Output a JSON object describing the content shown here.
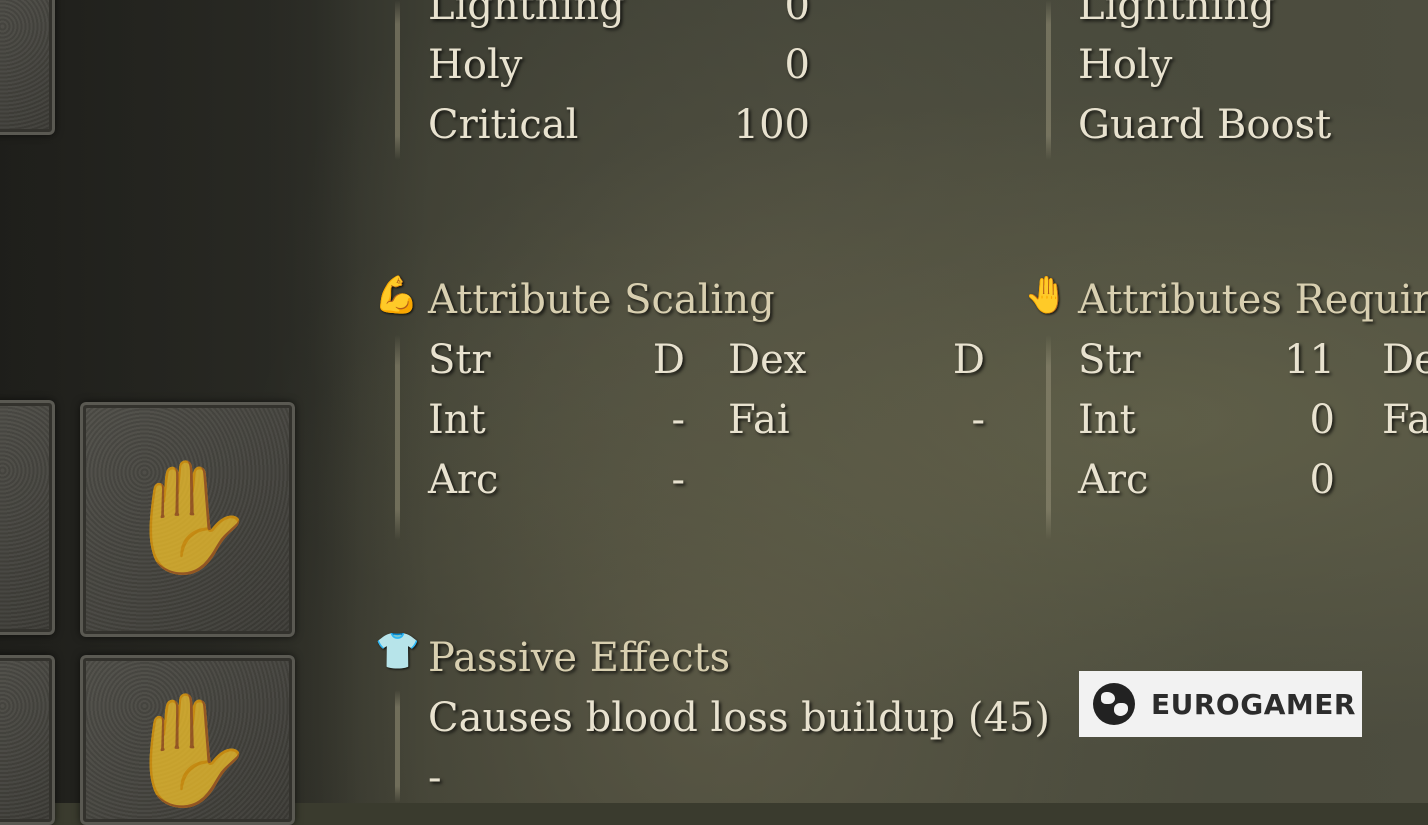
{
  "defense_left": {
    "rows": [
      {
        "label": "Lightning",
        "value": "0"
      },
      {
        "label": "Holy",
        "value": "0"
      },
      {
        "label": "Critical",
        "value": "100"
      }
    ]
  },
  "defense_right": {
    "rows": [
      {
        "label": "Lightning"
      },
      {
        "label": "Holy"
      },
      {
        "label": "Guard Boost"
      }
    ]
  },
  "attribute_scaling": {
    "title": "Attribute Scaling",
    "icon": "flexed-arm-icon",
    "rows": [
      {
        "label": "Str",
        "value": "D",
        "label2": "Dex",
        "value2": "D"
      },
      {
        "label": "Int",
        "value": "-",
        "label2": "Fai",
        "value2": "-"
      },
      {
        "label": "Arc",
        "value": "-"
      }
    ]
  },
  "attributes_required": {
    "title": "Attributes Required",
    "icon": "open-hand-icon",
    "rows": [
      {
        "label": "Str",
        "value": "11",
        "label2": "De"
      },
      {
        "label": "Int",
        "value": "0",
        "label2": "Fa"
      },
      {
        "label": "Arc",
        "value": "0"
      }
    ]
  },
  "passive_effects": {
    "title": "Passive Effects",
    "icon": "torso-icon",
    "effects": [
      "Causes blood loss buildup (45)",
      "-"
    ]
  },
  "watermark": {
    "text": "EUROGAMER",
    "icon": "globe-icon"
  }
}
